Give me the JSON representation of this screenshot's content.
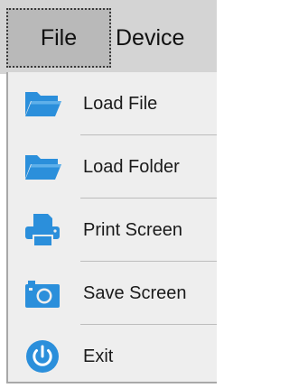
{
  "menubar": {
    "file_label": "File",
    "device_label": "Device"
  },
  "menu": {
    "items": [
      {
        "label": "Load File",
        "icon": "folder-icon"
      },
      {
        "label": "Load Folder",
        "icon": "folder-icon"
      },
      {
        "label": "Print Screen",
        "icon": "printer-icon"
      },
      {
        "label": "Save Screen",
        "icon": "camera-icon"
      },
      {
        "label": "Exit",
        "icon": "power-icon"
      }
    ]
  },
  "colors": {
    "icon_blue": "#2b8fdb",
    "menubar_bg": "#d4d4d4",
    "selected_menu_bg": "#b9b9b9",
    "dropdown_bg": "#eeeeee"
  }
}
